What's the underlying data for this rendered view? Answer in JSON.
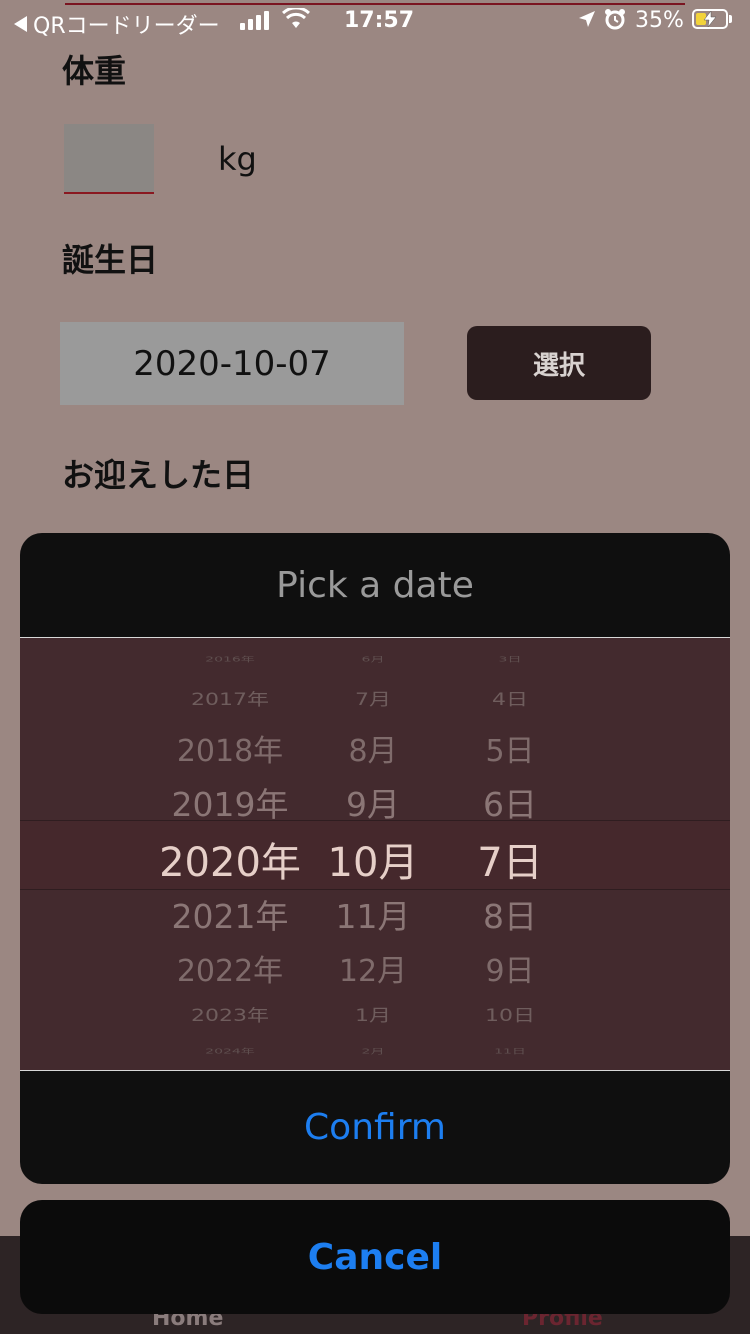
{
  "status_bar": {
    "back_app": "QRコードリーダー",
    "time": "17:57",
    "battery_percent": "35%",
    "battery_level": 0.35,
    "icons": [
      "back-arrow-icon",
      "cellular-signal-icon",
      "wifi-icon",
      "location-arrow-icon",
      "alarm-icon",
      "battery-charging-icon"
    ]
  },
  "form": {
    "weight_label": "体重",
    "weight_value": "",
    "weight_unit": "kg",
    "birthday_label": "誕生日",
    "birthday_value": "2020-10-07",
    "select_button": "選択",
    "welcome_label": "お迎えした日"
  },
  "picker": {
    "title": "Pick a date",
    "rows": [
      {
        "year": "2016年",
        "month": "6月",
        "day": "3日"
      },
      {
        "year": "2017年",
        "month": "7月",
        "day": "4日"
      },
      {
        "year": "2018年",
        "month": "8月",
        "day": "5日"
      },
      {
        "year": "2019年",
        "month": "9月",
        "day": "6日"
      },
      {
        "year": "2020年",
        "month": "10月",
        "day": "7日"
      },
      {
        "year": "2021年",
        "month": "11月",
        "day": "8日"
      },
      {
        "year": "2022年",
        "month": "12月",
        "day": "9日"
      },
      {
        "year": "2023年",
        "month": "1月",
        "day": "10日"
      },
      {
        "year": "2024年",
        "month": "2月",
        "day": "11日"
      }
    ],
    "selected": {
      "year": "2020年",
      "month": "10月",
      "day": "7日"
    },
    "confirm": "Confirm",
    "cancel": "Cancel"
  },
  "tab_bar": {
    "home": "Home",
    "profile": "Profile",
    "active": "Profile"
  },
  "colors": {
    "background": "#9b8782",
    "picker_wheel": "#432a2e",
    "sheet": "#0f0f0f",
    "action_blue": "#1d7ef0",
    "active_tab": "#6b2530"
  }
}
